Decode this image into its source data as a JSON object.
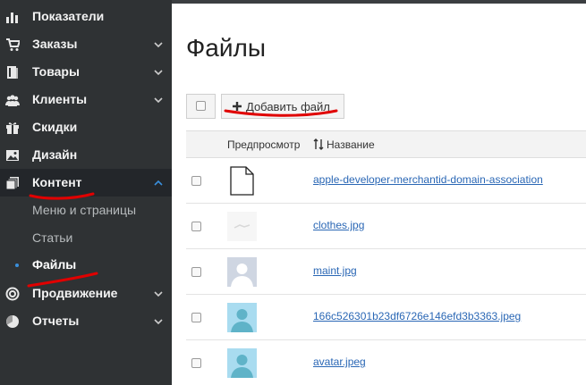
{
  "sidebar": {
    "items": [
      {
        "label": "Показатели",
        "icon": "bar-chart-icon"
      },
      {
        "label": "Заказы",
        "icon": "cart-icon"
      },
      {
        "label": "Товары",
        "icon": "book-icon"
      },
      {
        "label": "Клиенты",
        "icon": "users-icon"
      },
      {
        "label": "Скидки",
        "icon": "gift-icon"
      },
      {
        "label": "Дизайн",
        "icon": "image-icon"
      },
      {
        "label": "Контент",
        "icon": "files-icon"
      },
      {
        "label": "Продвижение",
        "icon": "target-icon"
      },
      {
        "label": "Отчеты",
        "icon": "pie-chart-icon"
      }
    ],
    "content_sub": [
      {
        "label": "Меню и страницы"
      },
      {
        "label": "Статьи"
      },
      {
        "label": "Файлы"
      }
    ]
  },
  "main": {
    "title": "Файлы",
    "add_button_label": "Добавить файл",
    "table": {
      "col_preview": "Предпросмотр",
      "col_name": "Название",
      "rows": [
        {
          "name": "apple-developer-merchantid-domain-association",
          "thumb": "document"
        },
        {
          "name": "clothes.jpg",
          "thumb": "image-faint"
        },
        {
          "name": "maint.jpg",
          "thumb": "avatar-gray"
        },
        {
          "name": "166c526301b23df6726e146efd3b3363.jpeg",
          "thumb": "avatar-blue"
        },
        {
          "name": "avatar.jpeg",
          "thumb": "avatar-blue"
        }
      ]
    }
  },
  "colors": {
    "sidebar_bg": "#2f3234",
    "sidebar_active_bg": "#23262a",
    "link": "#2a67b5",
    "annotation": "#e00000",
    "active_dot": "#3a8fdc"
  }
}
